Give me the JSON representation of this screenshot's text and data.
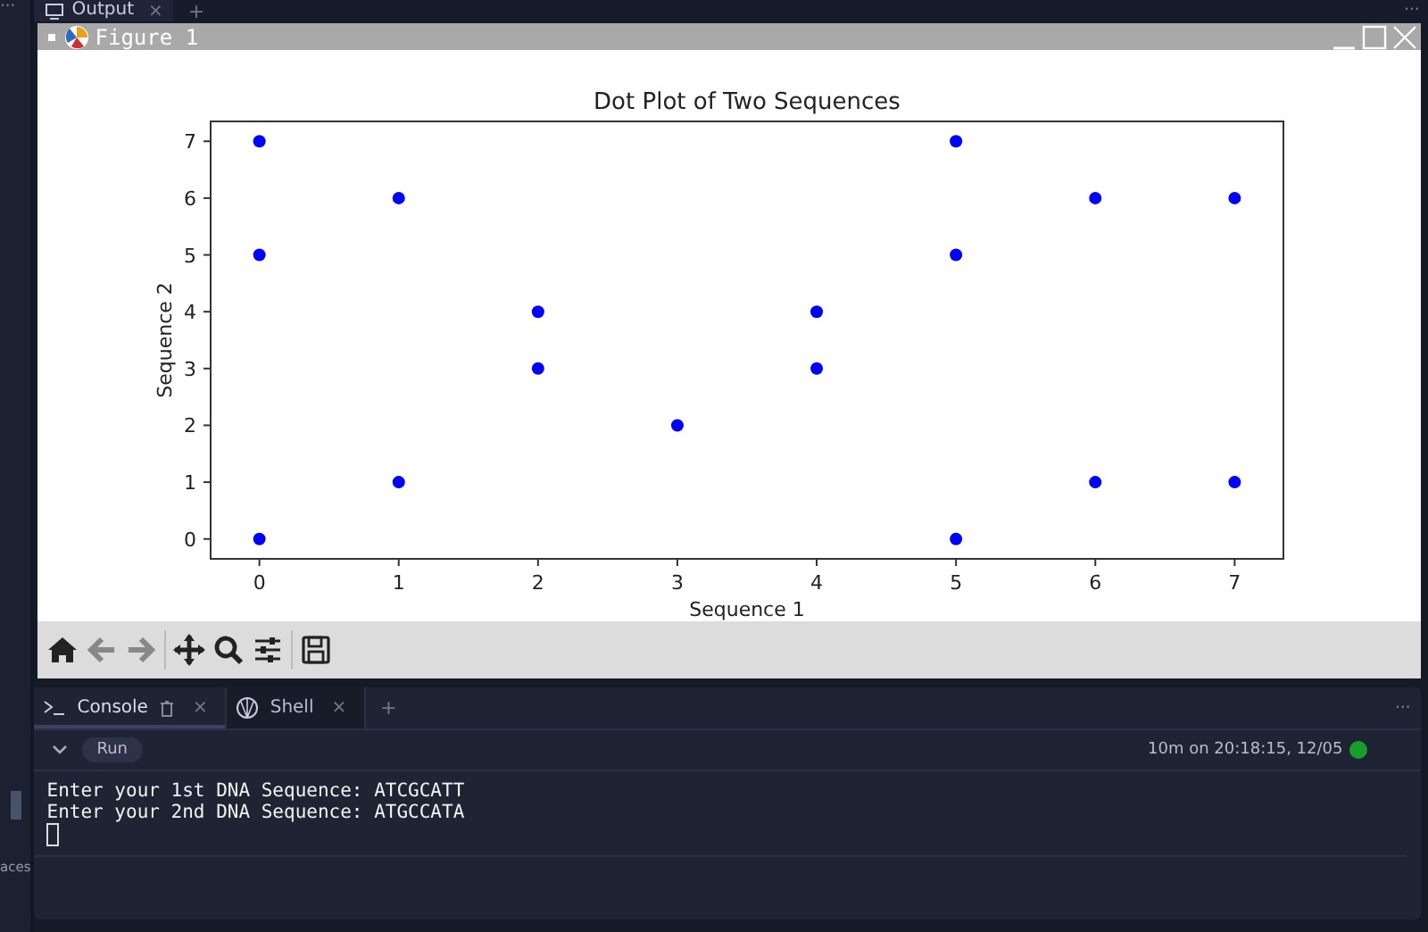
{
  "top_bar": {
    "left_menu": "···",
    "tab": {
      "label": "Output",
      "close": "×",
      "selected": true
    },
    "add": "+",
    "right_menu": "···"
  },
  "sidebar": {
    "fragment": "aces"
  },
  "figure_window": {
    "title": "Figure 1",
    "chart_data": {
      "type": "scatter",
      "title": "Dot Plot of Two Sequences",
      "xlabel": "Sequence 1",
      "ylabel": "Sequence 2",
      "xlim": [
        -0.35,
        7.35
      ],
      "ylim": [
        -0.35,
        7.35
      ],
      "xticks": [
        0,
        1,
        2,
        3,
        4,
        5,
        6,
        7
      ],
      "yticks": [
        0,
        1,
        2,
        3,
        4,
        5,
        6,
        7
      ],
      "x": [
        0,
        0,
        0,
        1,
        1,
        2,
        2,
        3,
        4,
        4,
        5,
        5,
        5,
        6,
        6,
        7,
        7
      ],
      "series": [
        {
          "color": "#0000ff",
          "values": [
            7,
            5,
            0,
            6,
            1,
            4,
            3,
            2,
            4,
            3,
            7,
            5,
            0,
            6,
            1,
            6,
            1
          ]
        }
      ]
    }
  },
  "console": {
    "tabs": [
      {
        "label": "Console",
        "kind": "console",
        "selected": true,
        "close": "×"
      },
      {
        "label": "Shell",
        "kind": "shell",
        "selected": false,
        "close": "×"
      }
    ],
    "add": "+",
    "menu": "···",
    "run_label": "Run",
    "status": "10m on 20:18:15, 12/05",
    "lines": [
      "Enter your 1st DNA Sequence: ATCGCATT",
      "Enter your 2nd DNA Sequence: ATGCCATA"
    ]
  }
}
